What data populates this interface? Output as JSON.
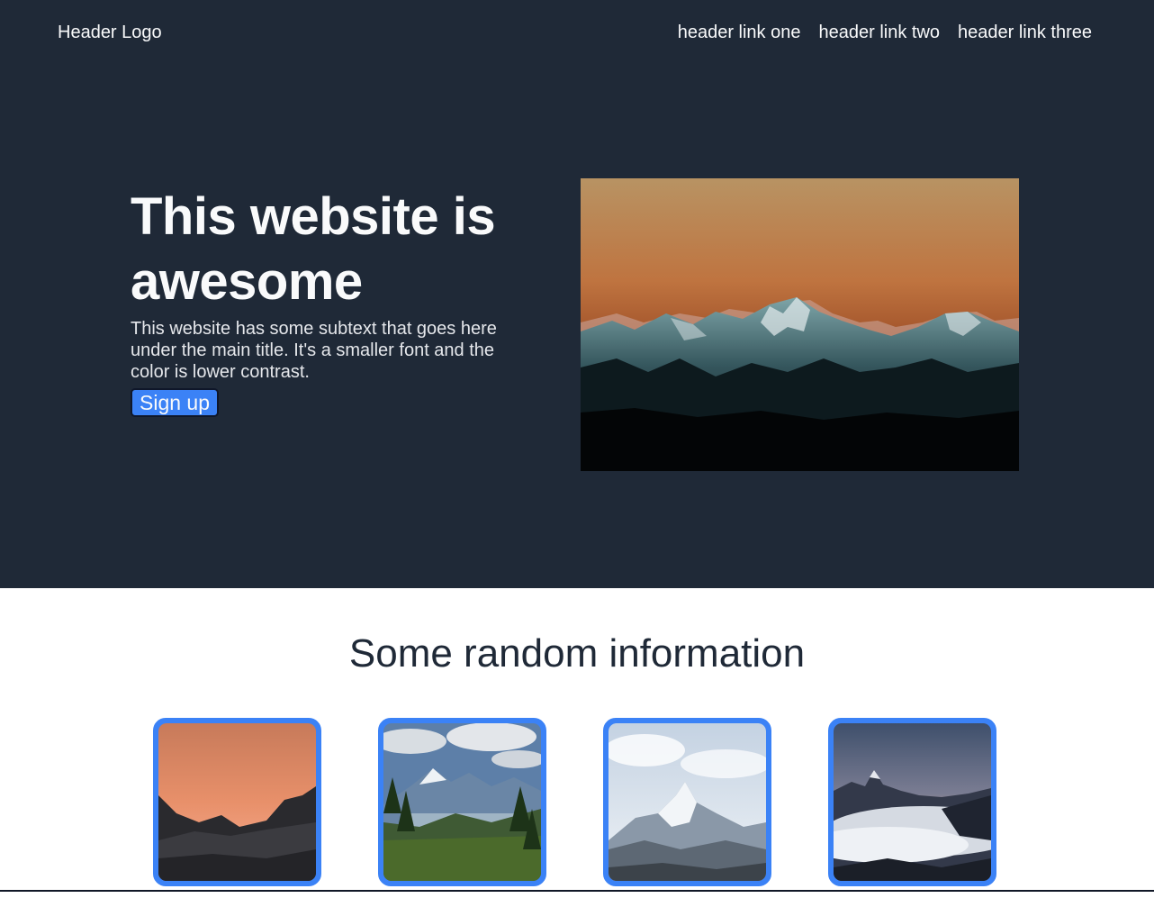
{
  "header": {
    "logo": "Header Logo",
    "links": [
      "header link one",
      "header link two",
      "header link three"
    ]
  },
  "hero": {
    "title": "This website is awesome",
    "subtext": "This website has some subtext that goes here under the main title. It's a smaller font and the color is lower contrast.",
    "button_label": "Sign up"
  },
  "info": {
    "title": "Some random information"
  },
  "colors": {
    "header_bg": "#1f2937",
    "accent": "#3b82f6",
    "text_light": "#f9fafb"
  }
}
